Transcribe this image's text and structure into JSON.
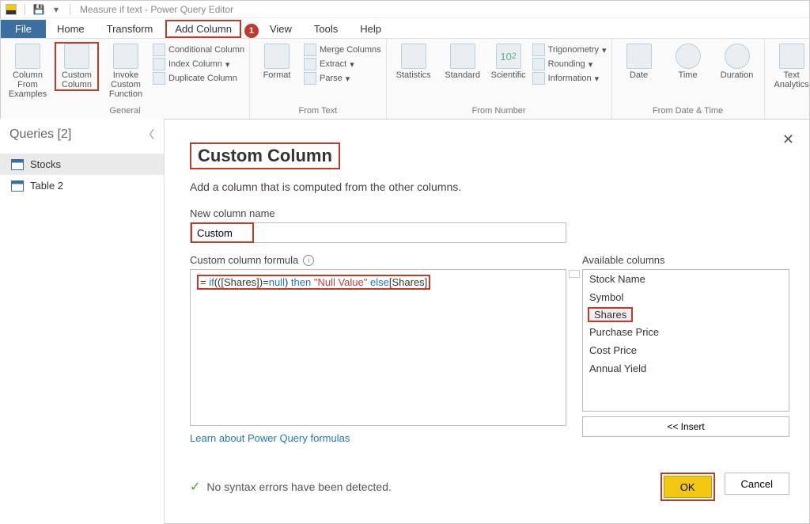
{
  "title": "Measure if text - Power Query Editor",
  "tabs": {
    "file": "File",
    "home": "Home",
    "transform": "Transform",
    "addcol": "Add Column",
    "view": "View",
    "tools": "Tools",
    "help": "Help"
  },
  "badge_num": "1",
  "ribbon": {
    "general": {
      "col_from_examples": "Column From Examples",
      "custom_col": "Custom Column",
      "invoke": "Invoke Custom Function",
      "conditional": "Conditional Column",
      "index": "Index Column",
      "duplicate": "Duplicate Column",
      "label": "General"
    },
    "from_text": {
      "format": "Format",
      "merge": "Merge Columns",
      "extract": "Extract",
      "parse": "Parse",
      "label": "From Text"
    },
    "from_number": {
      "stats": "Statistics",
      "standard": "Standard",
      "scientific": "Scientific",
      "ten": "10",
      "trig": "Trigonometry",
      "round": "Rounding",
      "info": "Information",
      "label": "From Number"
    },
    "from_date": {
      "date": "Date",
      "time": "Time",
      "duration": "Duration",
      "label": "From Date & Time"
    },
    "text_an": "Text Analytics"
  },
  "queries": {
    "header": "Queries [2]",
    "items": [
      "Stocks",
      "Table 2"
    ]
  },
  "dialog": {
    "title": "Custom Column",
    "subtitle": "Add a column that is computed from the other columns.",
    "new_col_label": "New column name",
    "new_col_value": "Custom",
    "formula_label": "Custom column formula",
    "formula": {
      "eq": "= ",
      "if": "if",
      "p1": "(([Shares])=",
      "null": "null",
      "p2": ") ",
      "then": "then",
      "sp": " ",
      "str": "\"Null Value\"",
      "sp2": " ",
      "else": "else",
      "tail": "[Shares]"
    },
    "avail_label": "Available columns",
    "avail_cols": [
      "Stock Name",
      "Symbol",
      "Shares",
      "Purchase Price",
      "Cost Price",
      "Annual Yield"
    ],
    "insert": "<< Insert",
    "learn": "Learn about Power Query formulas",
    "status": "No syntax errors have been detected.",
    "ok": "OK",
    "cancel": "Cancel"
  }
}
